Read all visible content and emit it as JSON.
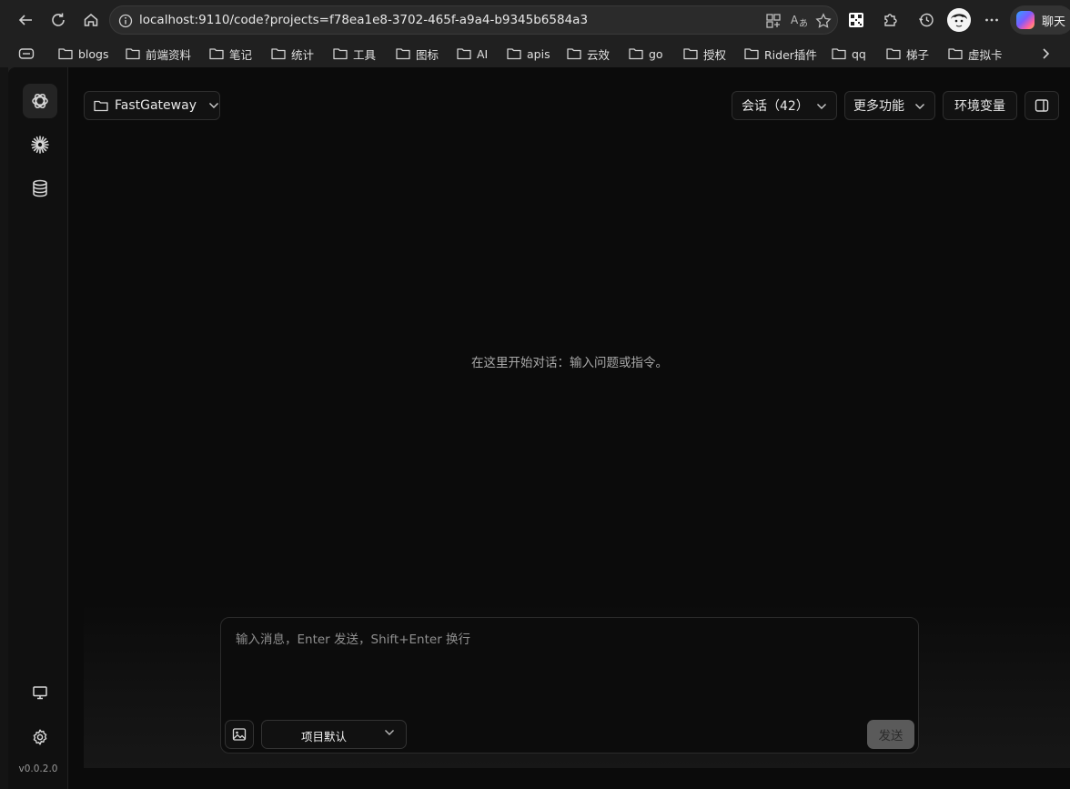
{
  "browser": {
    "url": "localhost:9110/code?projects=f78ea1e8-3702-465f-a9a4-b9345b6584a3",
    "chat_label": "聊天",
    "bookmarks": [
      "blogs",
      "前端资料",
      "笔记",
      "统计",
      "工具",
      "图标",
      "AI",
      "apis",
      "云效",
      "go",
      "授权",
      "Rider插件",
      "qq",
      "梯子",
      "虚拟卡"
    ]
  },
  "app": {
    "version": "v0.0.2.0",
    "project_label": "FastGateway",
    "sessions_label": "会话（42）",
    "more_label": "更多功能",
    "env_label": "环境变量",
    "empty_text": "在这里开始对话：输入问题或指令。",
    "composer": {
      "placeholder": "输入消息，Enter 发送，Shift+Enter 换行",
      "model_value": "项目默认",
      "send_label": "发送"
    }
  },
  "colors": {
    "background": "#0b0b0b",
    "sidebar": "#101010",
    "border": "#2e2e2e",
    "send_button": "#5a5a5a"
  }
}
